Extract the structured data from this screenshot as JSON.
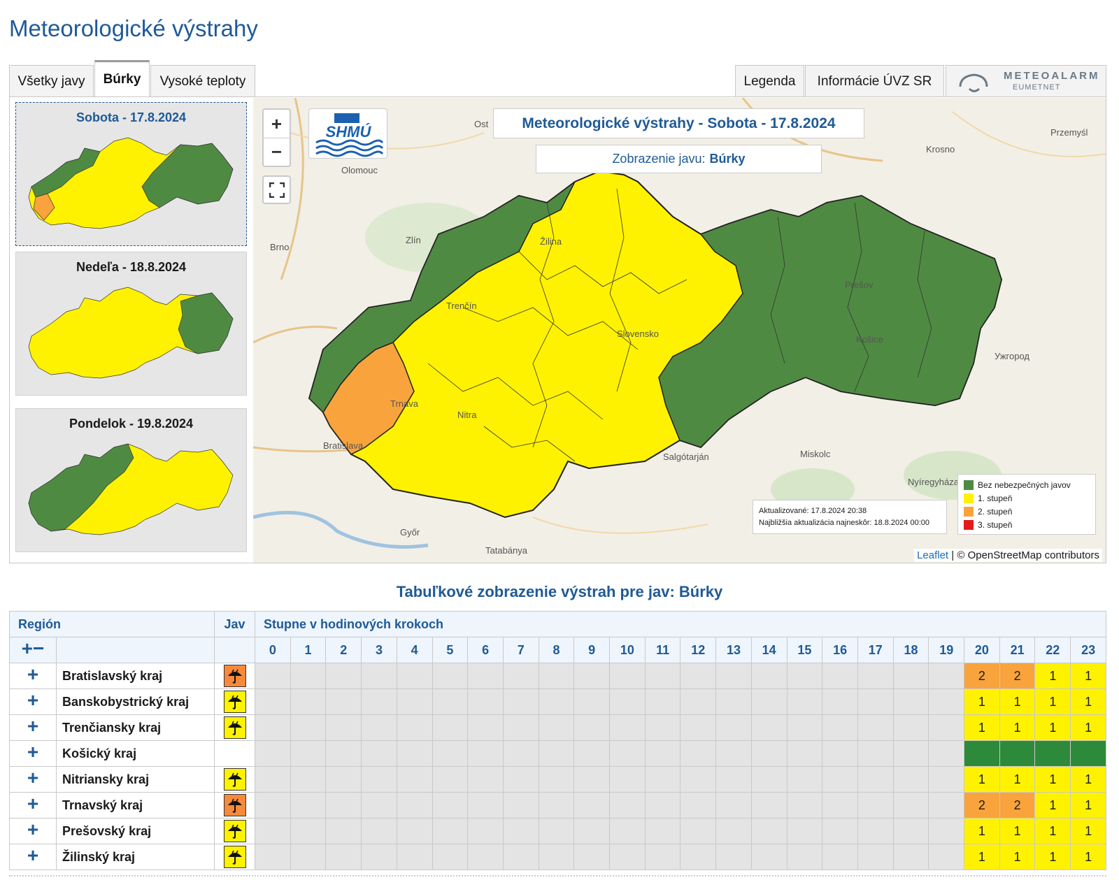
{
  "page": {
    "title": "Meteorologické výstrahy"
  },
  "tabs": [
    {
      "label": "Všetky javy",
      "active": false
    },
    {
      "label": "Búrky",
      "active": true
    },
    {
      "label": "Vysoké teploty",
      "active": false
    }
  ],
  "right_tabs": {
    "legend": "Legenda",
    "info": "Informácie ÚVZ SR",
    "meteoalarm_top": "METEOALARM",
    "meteoalarm_bottom": "EUMETNET"
  },
  "days": [
    {
      "title": "Sobota - 17.8.2024",
      "active": true
    },
    {
      "title": "Nedeľa - 18.8.2024",
      "active": false
    },
    {
      "title": "Pondelok - 19.8.2024",
      "active": false
    }
  ],
  "map": {
    "zoom_in": "+",
    "zoom_out": "−",
    "logo_text": "SHMÚ",
    "title": "Meteorologické výstrahy - Sobota - 17.8.2024",
    "subtitle_prefix": "Zobrazenie javu:",
    "subtitle_value": "Búrky",
    "updated": "Aktualizované: 17.8.2024 20:38",
    "next_update": "Najbližšia aktualizácia najneskôr: 18.8.2024 00:00",
    "legend": [
      {
        "label": "Bez nebezpečných javov",
        "color": "#4f8a43"
      },
      {
        "label": "1. stupeň",
        "color": "#fff200"
      },
      {
        "label": "2. stupeň",
        "color": "#f9a33c"
      },
      {
        "label": "3. stupeň",
        "color": "#e51b1b"
      }
    ],
    "attribution_leaflet": "Leaflet",
    "attribution_rest": "| © OpenStreetMap contributors",
    "places": {
      "olomouc": "Olomouc",
      "brno": "Brno",
      "zlin": "Zlín",
      "zilina": "Žilina",
      "trencin": "Trenčín",
      "trnava": "Trnava",
      "bratislava": "Bratislava",
      "nitra": "Nitra",
      "slovensko": "Slovensko",
      "presov": "Prešov",
      "kosice": "Košice",
      "krosno": "Krosno",
      "przemysl": "Przemyśl",
      "uzhorod": "Ужгород",
      "salgotarjan": "Salgótarján",
      "miskolc": "Miskolc",
      "nyiregyhaza": "Nyíregyháza",
      "gyor": "Győr",
      "tatabanya": "Tatabánya",
      "ost": "Ost"
    }
  },
  "table": {
    "title": "Tabuľkové zobrazenie výstrah pre jav: Búrky",
    "header": {
      "region": "Región",
      "jav": "Jav",
      "steps": "Stupne v hodinových krokoch",
      "expand_all": "+",
      "collapse_all": "−"
    },
    "hours": [
      "0",
      "1",
      "2",
      "3",
      "4",
      "5",
      "6",
      "7",
      "8",
      "9",
      "10",
      "11",
      "12",
      "13",
      "14",
      "15",
      "16",
      "17",
      "18",
      "19",
      "20",
      "21",
      "22",
      "23"
    ],
    "rows": [
      {
        "region": "Bratislavský kraj",
        "icon": "storm-orange",
        "levels": [
          2,
          2,
          1,
          1
        ]
      },
      {
        "region": "Banskobystrický kraj",
        "icon": "storm-yellow",
        "levels": [
          1,
          1,
          1,
          1
        ]
      },
      {
        "region": "Trenčiansky kraj",
        "icon": "storm-yellow",
        "levels": [
          1,
          1,
          1,
          1
        ]
      },
      {
        "region": "Košický kraj",
        "icon": "",
        "levels": [
          0,
          0,
          0,
          0
        ]
      },
      {
        "region": "Nitriansky kraj",
        "icon": "storm-yellow",
        "levels": [
          1,
          1,
          1,
          1
        ]
      },
      {
        "region": "Trnavský kraj",
        "icon": "storm-orange",
        "levels": [
          2,
          2,
          1,
          1
        ]
      },
      {
        "region": "Prešovský kraj",
        "icon": "storm-yellow",
        "levels": [
          1,
          1,
          1,
          1
        ]
      },
      {
        "region": "Žilinský kraj",
        "icon": "storm-yellow",
        "levels": [
          1,
          1,
          1,
          1
        ]
      }
    ],
    "expand_symbol": "+"
  }
}
